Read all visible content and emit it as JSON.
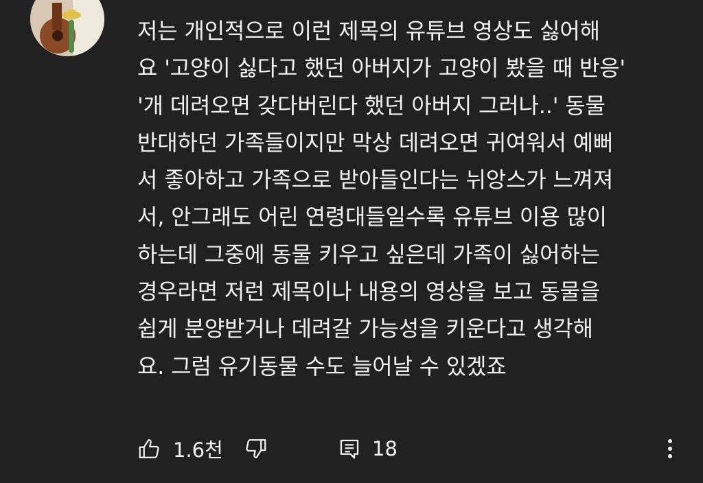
{
  "comment": {
    "author_partial": "",
    "lines": [
      "저는 개인적으로 이런 제목의 유튜브 영상도 싫어해",
      "요 '고양이 싫다고 했던 아버지가 고양이 봤을 때 반응'",
      "'개 데려오면 갖다버린다 했던 아버지 그러나..' 동물",
      "반대하던 가족들이지만 막상 데려오면 귀여워서 예뻐",
      "서 좋아하고 가족으로 받아들인다는 뉘앙스가 느껴져",
      "서, 안그래도 어린 연령대들일수록 유튜브 이용 많이",
      "하는데 그중에 동물 키우고 싶은데 가족이 싫어하는",
      "경우라면 저런 제목이나 내용의 영상을 보고 동물을",
      "쉽게 분양받거나 데려갈 가능성을 키운다고 생각해",
      "요. 그럼 유기동물 수도 늘어날 수 있겠죠"
    ]
  },
  "actions": {
    "like_count": "1.6천",
    "reply_count": "18",
    "icons": {
      "like": "thumbs-up-icon",
      "dislike": "thumbs-down-icon",
      "reply": "comment-icon",
      "more": "more-vertical-icon"
    }
  }
}
